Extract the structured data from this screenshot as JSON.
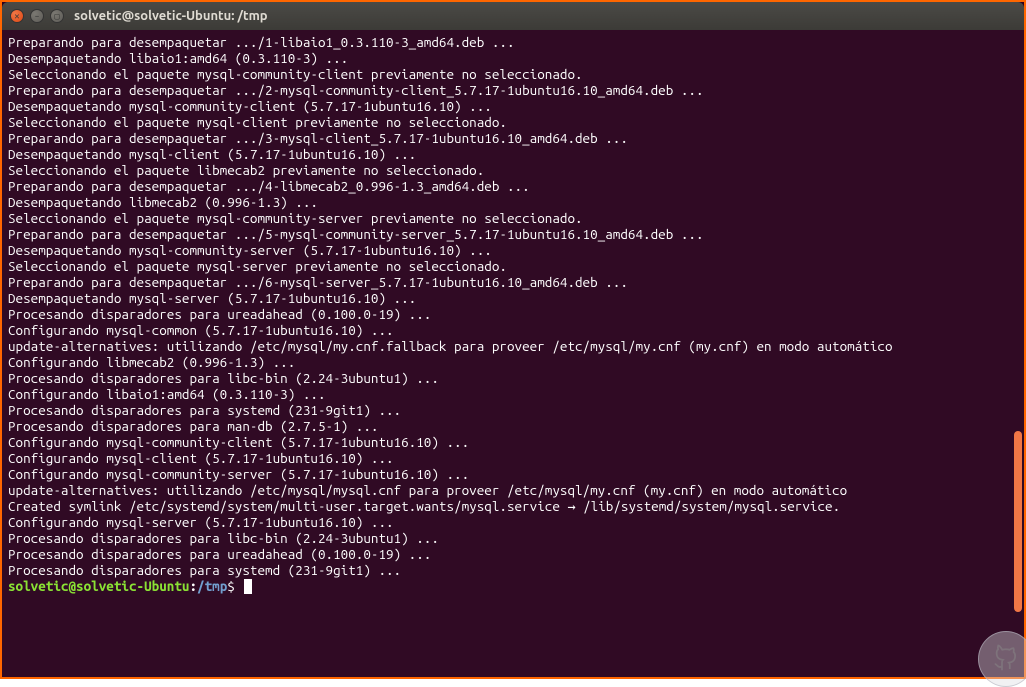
{
  "window": {
    "title": "solvetic@solvetic-Ubuntu: /tmp"
  },
  "prompt": {
    "user_host": "solvetic@solvetic-Ubuntu",
    "path": "/tmp",
    "symbol": "$"
  },
  "scrollbar": {
    "thumb_top_pct": 62,
    "thumb_height_pct": 28
  },
  "lines": [
    "Preparando para desempaquetar .../1-libaio1_0.3.110-3_amd64.deb ...",
    "Desempaquetando libaio1:amd64 (0.3.110-3) ...",
    "Seleccionando el paquete mysql-community-client previamente no seleccionado.",
    "Preparando para desempaquetar .../2-mysql-community-client_5.7.17-1ubuntu16.10_amd64.deb ...",
    "Desempaquetando mysql-community-client (5.7.17-1ubuntu16.10) ...",
    "Seleccionando el paquete mysql-client previamente no seleccionado.",
    "Preparando para desempaquetar .../3-mysql-client_5.7.17-1ubuntu16.10_amd64.deb ...",
    "Desempaquetando mysql-client (5.7.17-1ubuntu16.10) ...",
    "Seleccionando el paquete libmecab2 previamente no seleccionado.",
    "Preparando para desempaquetar .../4-libmecab2_0.996-1.3_amd64.deb ...",
    "Desempaquetando libmecab2 (0.996-1.3) ...",
    "Seleccionando el paquete mysql-community-server previamente no seleccionado.",
    "Preparando para desempaquetar .../5-mysql-community-server_5.7.17-1ubuntu16.10_amd64.deb ...",
    "Desempaquetando mysql-community-server (5.7.17-1ubuntu16.10) ...",
    "Seleccionando el paquete mysql-server previamente no seleccionado.",
    "Preparando para desempaquetar .../6-mysql-server_5.7.17-1ubuntu16.10_amd64.deb ...",
    "Desempaquetando mysql-server (5.7.17-1ubuntu16.10) ...",
    "Procesando disparadores para ureadahead (0.100.0-19) ...",
    "Configurando mysql-common (5.7.17-1ubuntu16.10) ...",
    "update-alternatives: utilizando /etc/mysql/my.cnf.fallback para proveer /etc/mysql/my.cnf (my.cnf) en modo automático",
    "Configurando libmecab2 (0.996-1.3) ...",
    "Procesando disparadores para libc-bin (2.24-3ubuntu1) ...",
    "Configurando libaio1:amd64 (0.3.110-3) ...",
    "Procesando disparadores para systemd (231-9git1) ...",
    "Procesando disparadores para man-db (2.7.5-1) ...",
    "Configurando mysql-community-client (5.7.17-1ubuntu16.10) ...",
    "Configurando mysql-client (5.7.17-1ubuntu16.10) ...",
    "Configurando mysql-community-server (5.7.17-1ubuntu16.10) ...",
    "update-alternatives: utilizando /etc/mysql/mysql.cnf para proveer /etc/mysql/my.cnf (my.cnf) en modo automático",
    "Created symlink /etc/systemd/system/multi-user.target.wants/mysql.service → /lib/systemd/system/mysql.service.",
    "Configurando mysql-server (5.7.17-1ubuntu16.10) ...",
    "Procesando disparadores para libc-bin (2.24-3ubuntu1) ...",
    "Procesando disparadores para ureadahead (0.100.0-19) ...",
    "Procesando disparadores para systemd (231-9git1) ..."
  ]
}
